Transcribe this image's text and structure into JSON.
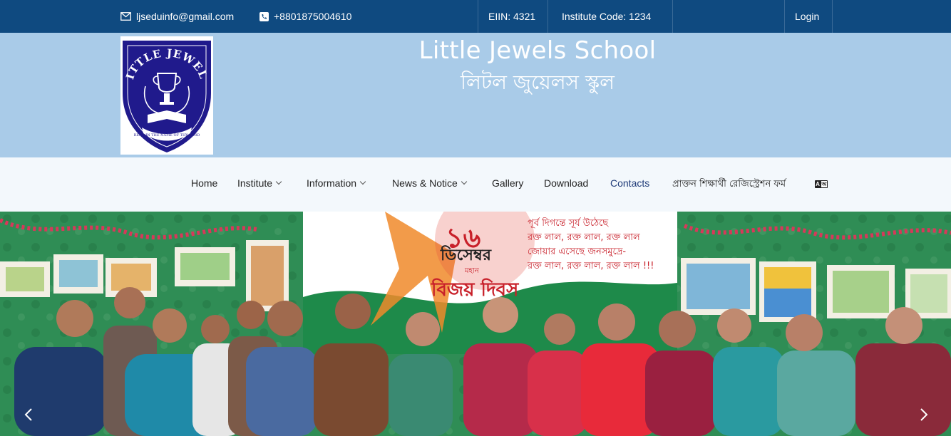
{
  "topbar": {
    "email": "ljseduinfo@gmail.com",
    "phone": "+8801875004610",
    "eiin": "EIIN: 4321",
    "institute_code": "Institute Code: 1234",
    "login": "Login",
    "icons": [
      "envelope-icon",
      "phone-icon"
    ]
  },
  "header": {
    "title_en": "Little Jewels School",
    "title_bn": "লিটল জুয়েলস স্কুল",
    "logo": {
      "top_text": "LITTLE JEWELS",
      "bottom_text": "READ IN THE NAME OF THY LORD"
    }
  },
  "nav": {
    "items": [
      {
        "label": "Home"
      },
      {
        "label": "Institute"
      },
      {
        "label": "Information"
      },
      {
        "label": "News & Notice"
      },
      {
        "label": "Gallery"
      },
      {
        "label": "Download"
      },
      {
        "label": "Contacts"
      },
      {
        "label": "প্রাক্তন শিক্ষার্থী রেজিস্ট্রেশন ফর্ম"
      }
    ],
    "language_icon": "translate-icon"
  },
  "hero": {
    "banner": {
      "number": "১৬",
      "month": "ডিসেম্বর",
      "subtitle": "মহান",
      "event": "বিজয় দিবস",
      "poem": [
        "পূর্ব দিগন্তে সূর্য উঠেছে",
        "রক্ত লাল, রক্ত লাল, রক্ত লাল",
        "জোয়ার এসেছে জনসমুদ্রে-",
        "রক্ত লাল, রক্ত লাল, রক্ত লাল !!!"
      ]
    },
    "prev_icon": "chevron-left-icon",
    "next_icon": "chevron-right-icon"
  },
  "colors": {
    "topbar": "#0f4a80",
    "header": "#a9cbe8",
    "nav_bg": "#f3f8fc",
    "active_link": "#1e3a78",
    "banner_red": "#c8202a",
    "banner_green": "#2c8a52"
  }
}
